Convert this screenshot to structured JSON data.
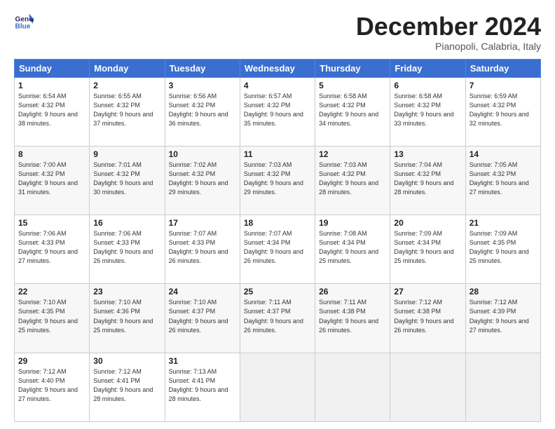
{
  "logo": {
    "text_general": "General",
    "text_blue": "Blue"
  },
  "header": {
    "title": "December 2024",
    "location": "Pianopoli, Calabria, Italy"
  },
  "weekdays": [
    "Sunday",
    "Monday",
    "Tuesday",
    "Wednesday",
    "Thursday",
    "Friday",
    "Saturday"
  ],
  "weeks": [
    [
      {
        "day": "1",
        "sunrise": "6:54 AM",
        "sunset": "4:32 PM",
        "daylight": "9 hours and 38 minutes."
      },
      {
        "day": "2",
        "sunrise": "6:55 AM",
        "sunset": "4:32 PM",
        "daylight": "9 hours and 37 minutes."
      },
      {
        "day": "3",
        "sunrise": "6:56 AM",
        "sunset": "4:32 PM",
        "daylight": "9 hours and 36 minutes."
      },
      {
        "day": "4",
        "sunrise": "6:57 AM",
        "sunset": "4:32 PM",
        "daylight": "9 hours and 35 minutes."
      },
      {
        "day": "5",
        "sunrise": "6:58 AM",
        "sunset": "4:32 PM",
        "daylight": "9 hours and 34 minutes."
      },
      {
        "day": "6",
        "sunrise": "6:58 AM",
        "sunset": "4:32 PM",
        "daylight": "9 hours and 33 minutes."
      },
      {
        "day": "7",
        "sunrise": "6:59 AM",
        "sunset": "4:32 PM",
        "daylight": "9 hours and 32 minutes."
      }
    ],
    [
      {
        "day": "8",
        "sunrise": "7:00 AM",
        "sunset": "4:32 PM",
        "daylight": "9 hours and 31 minutes."
      },
      {
        "day": "9",
        "sunrise": "7:01 AM",
        "sunset": "4:32 PM",
        "daylight": "9 hours and 30 minutes."
      },
      {
        "day": "10",
        "sunrise": "7:02 AM",
        "sunset": "4:32 PM",
        "daylight": "9 hours and 29 minutes."
      },
      {
        "day": "11",
        "sunrise": "7:03 AM",
        "sunset": "4:32 PM",
        "daylight": "9 hours and 29 minutes."
      },
      {
        "day": "12",
        "sunrise": "7:03 AM",
        "sunset": "4:32 PM",
        "daylight": "9 hours and 28 minutes."
      },
      {
        "day": "13",
        "sunrise": "7:04 AM",
        "sunset": "4:32 PM",
        "daylight": "9 hours and 28 minutes."
      },
      {
        "day": "14",
        "sunrise": "7:05 AM",
        "sunset": "4:32 PM",
        "daylight": "9 hours and 27 minutes."
      }
    ],
    [
      {
        "day": "15",
        "sunrise": "7:06 AM",
        "sunset": "4:33 PM",
        "daylight": "9 hours and 27 minutes."
      },
      {
        "day": "16",
        "sunrise": "7:06 AM",
        "sunset": "4:33 PM",
        "daylight": "9 hours and 26 minutes."
      },
      {
        "day": "17",
        "sunrise": "7:07 AM",
        "sunset": "4:33 PM",
        "daylight": "9 hours and 26 minutes."
      },
      {
        "day": "18",
        "sunrise": "7:07 AM",
        "sunset": "4:34 PM",
        "daylight": "9 hours and 26 minutes."
      },
      {
        "day": "19",
        "sunrise": "7:08 AM",
        "sunset": "4:34 PM",
        "daylight": "9 hours and 25 minutes."
      },
      {
        "day": "20",
        "sunrise": "7:09 AM",
        "sunset": "4:34 PM",
        "daylight": "9 hours and 25 minutes."
      },
      {
        "day": "21",
        "sunrise": "7:09 AM",
        "sunset": "4:35 PM",
        "daylight": "9 hours and 25 minutes."
      }
    ],
    [
      {
        "day": "22",
        "sunrise": "7:10 AM",
        "sunset": "4:35 PM",
        "daylight": "9 hours and 25 minutes."
      },
      {
        "day": "23",
        "sunrise": "7:10 AM",
        "sunset": "4:36 PM",
        "daylight": "9 hours and 25 minutes."
      },
      {
        "day": "24",
        "sunrise": "7:10 AM",
        "sunset": "4:37 PM",
        "daylight": "9 hours and 26 minutes."
      },
      {
        "day": "25",
        "sunrise": "7:11 AM",
        "sunset": "4:37 PM",
        "daylight": "9 hours and 26 minutes."
      },
      {
        "day": "26",
        "sunrise": "7:11 AM",
        "sunset": "4:38 PM",
        "daylight": "9 hours and 26 minutes."
      },
      {
        "day": "27",
        "sunrise": "7:12 AM",
        "sunset": "4:38 PM",
        "daylight": "9 hours and 26 minutes."
      },
      {
        "day": "28",
        "sunrise": "7:12 AM",
        "sunset": "4:39 PM",
        "daylight": "9 hours and 27 minutes."
      }
    ],
    [
      {
        "day": "29",
        "sunrise": "7:12 AM",
        "sunset": "4:40 PM",
        "daylight": "9 hours and 27 minutes."
      },
      {
        "day": "30",
        "sunrise": "7:12 AM",
        "sunset": "4:41 PM",
        "daylight": "9 hours and 28 minutes."
      },
      {
        "day": "31",
        "sunrise": "7:13 AM",
        "sunset": "4:41 PM",
        "daylight": "9 hours and 28 minutes."
      },
      null,
      null,
      null,
      null
    ]
  ]
}
